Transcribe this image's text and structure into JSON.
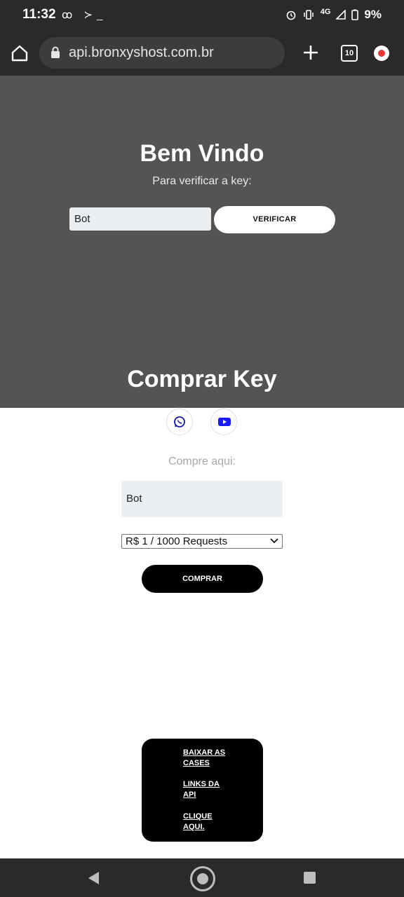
{
  "status_bar": {
    "time": "11:32",
    "left_icons": "ꝏ ≻_",
    "network": "4G",
    "battery": "9%"
  },
  "browser": {
    "url": "api.bronxyshost.com.br",
    "tab_count": "10"
  },
  "hero": {
    "title": "Bem Vindo",
    "subtitle": "Para verificar a key:",
    "key_input_value": "Bot",
    "verify_label": "VERIFICAR",
    "buy_title": "Comprar Key"
  },
  "buy": {
    "label": "Compre aqui:",
    "input_value": "Bot",
    "selected_plan": "R$ 1 / 1000 Requests",
    "buy_label": "COMPRAR"
  },
  "links": [
    {
      "label": "BAIXAR AS CASES"
    },
    {
      "label": "LINKS DA API"
    },
    {
      "label": "CLIQUE AQUI."
    }
  ],
  "colors": {
    "hero_bg": "#545454",
    "bar_bg": "#2a2a2a",
    "youtube_icon": "#1a1aff",
    "whatsapp_icon": "#1a1aa8"
  }
}
